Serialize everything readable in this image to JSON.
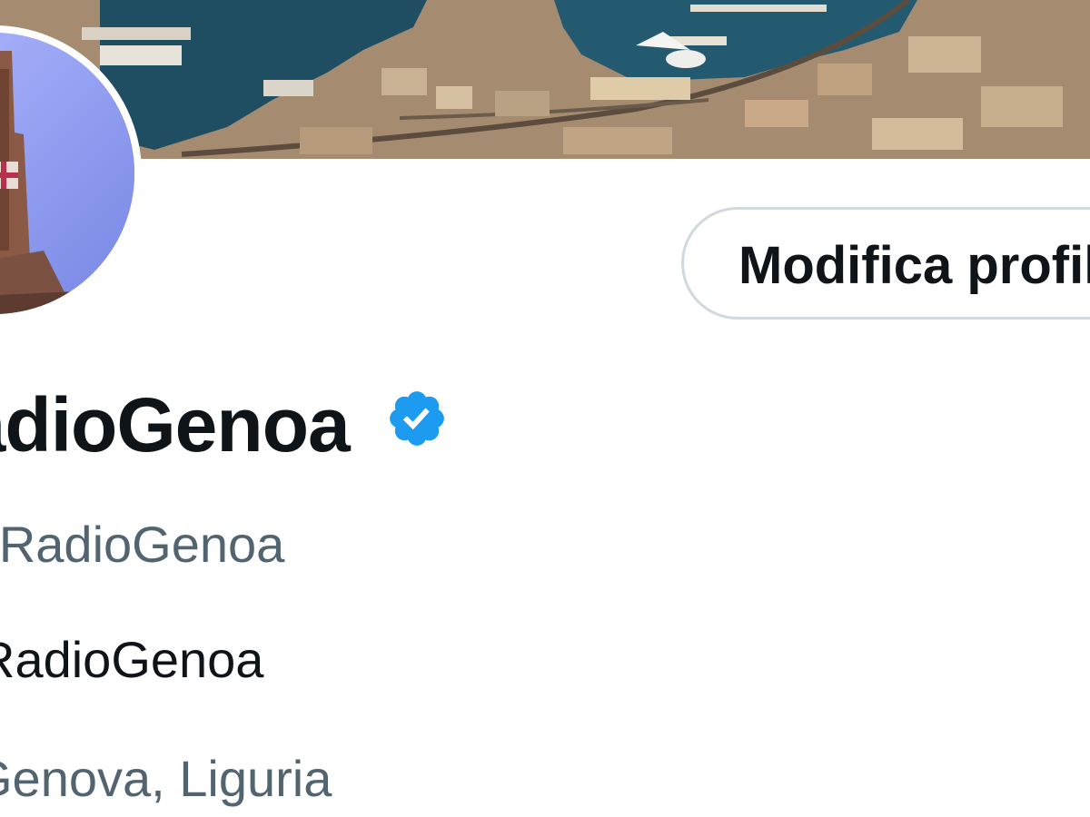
{
  "profile": {
    "display_name": "RadioGenoa",
    "handle": "@RadioGenoa",
    "bio": "RadioGenoa",
    "location": "Genova, Liguria",
    "edit_profile_label": "Modifica profilo"
  },
  "icons": {
    "verified": "verified-badge-icon"
  },
  "colors": {
    "text_primary": "#0f1419",
    "text_secondary": "#536471",
    "verified_blue": "#1d9bf0",
    "button_border": "#cfd9de"
  }
}
